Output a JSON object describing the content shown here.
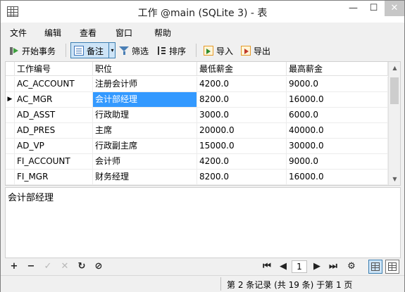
{
  "window": {
    "title": "工作 @main (SQLite 3) - 表",
    "minimize_glyph": "—",
    "maximize_glyph": "☐",
    "close_glyph": "✕",
    "app_icon": "table-icon"
  },
  "menu": [
    "文件",
    "编辑",
    "查看",
    "窗口",
    "帮助"
  ],
  "toolbar": {
    "begin_transaction": "开始事务",
    "memo": "备注",
    "memo_dropdown": "▾",
    "filter": "筛选",
    "sort": "排序",
    "import": "导入",
    "export": "导出"
  },
  "grid": {
    "columns": [
      "工作编号",
      "职位",
      "最低薪金",
      "最高薪金"
    ],
    "current_row_marker": "▶",
    "rows": [
      [
        "AC_ACCOUNT",
        "注册会计师",
        "4200.0",
        "9000.0"
      ],
      [
        "AC_MGR",
        "会计部经理",
        "8200.0",
        "16000.0"
      ],
      [
        "AD_ASST",
        "行政助理",
        "3000.0",
        "6000.0"
      ],
      [
        "AD_PRES",
        "主席",
        "20000.0",
        "40000.0"
      ],
      [
        "AD_VP",
        "行政副主席",
        "15000.0",
        "30000.0"
      ],
      [
        "FI_ACCOUNT",
        "会计师",
        "4200.0",
        "9000.0"
      ],
      [
        "FI_MGR",
        "财务经理",
        "8200.0",
        "16000.0"
      ]
    ],
    "selected": {
      "row": 1,
      "col": 1
    },
    "scroll_up": "▲",
    "scroll_down": "▼"
  },
  "memo_text": "会计部经理",
  "bottom": {
    "add": "+",
    "delete": "−",
    "apply": "✓",
    "discard": "✕",
    "refresh": "↻",
    "stop": "⊘",
    "first": "⏮",
    "prev": "◀",
    "page": "1",
    "next": "▶",
    "last": "⏭",
    "settings": "⚙"
  },
  "status": "第 2 条记录 (共 19 条) 于第 1 页",
  "colors": {
    "selection": "#3399ff",
    "toolbar_active": "#cde4f7",
    "close_button": "#c7c7c7"
  }
}
